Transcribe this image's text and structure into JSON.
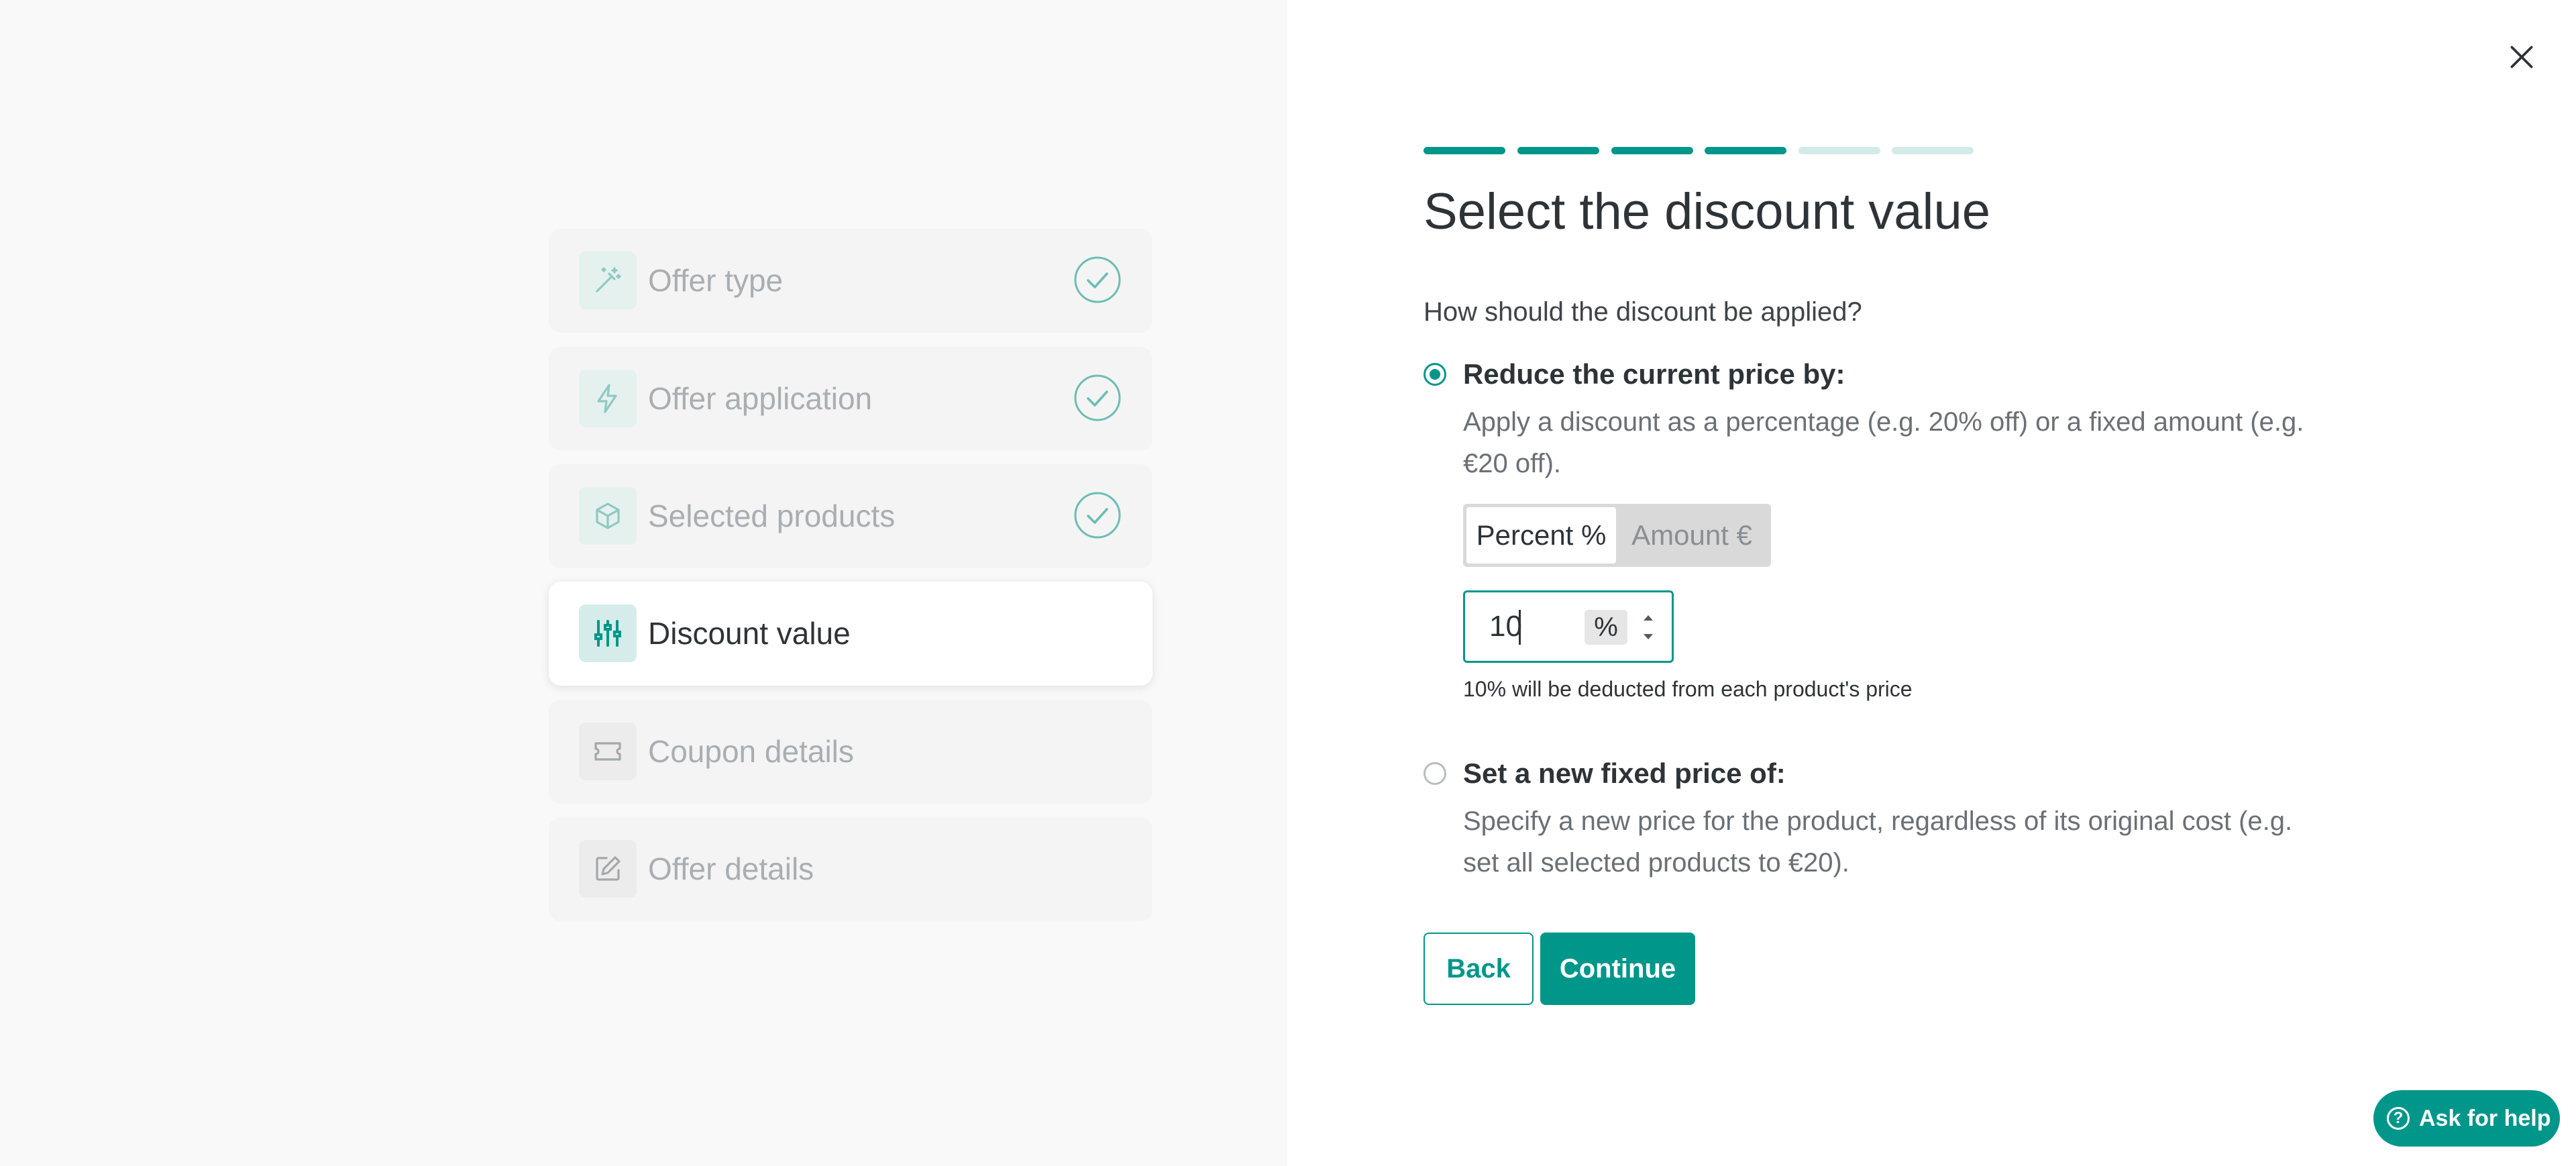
{
  "colors": {
    "accent": "#00968a",
    "accent_light": "#d3ebe8",
    "muted_text": "#a9aeb2"
  },
  "steps": [
    {
      "label": "Offer type",
      "icon": "magic-wand-icon",
      "status": "completed"
    },
    {
      "label": "Offer application",
      "icon": "lightning-icon",
      "status": "completed"
    },
    {
      "label": "Selected products",
      "icon": "box-icon",
      "status": "completed"
    },
    {
      "label": "Discount value",
      "icon": "sliders-icon",
      "status": "active"
    },
    {
      "label": "Coupon details",
      "icon": "ticket-icon",
      "status": "pending"
    },
    {
      "label": "Offer details",
      "icon": "edit-icon",
      "status": "pending"
    }
  ],
  "progress": {
    "total_steps": 6,
    "completed_steps": 4
  },
  "main": {
    "title": "Select the discount value",
    "question": "How should the discount be applied?",
    "option_reduce": {
      "title": "Reduce the current price by:",
      "description": "Apply a discount as a percentage (e.g. 20% off) or a fixed amount (e.g. €20 off).",
      "selected": true
    },
    "segmented": {
      "percent_label": "Percent %",
      "amount_label": "Amount €",
      "selected": "percent"
    },
    "value_input": {
      "value": "10",
      "unit": "%"
    },
    "hint": "10% will be deducted from each product's price",
    "option_fixed": {
      "title": "Set a new fixed price of:",
      "description": "Specify a new price for the product, regardless of its original cost (e.g. set all selected products to €20).",
      "selected": false
    },
    "back_label": "Back",
    "continue_label": "Continue"
  },
  "help": {
    "label": "Ask for help",
    "icon": "question-circle-icon"
  },
  "close_icon": "close-icon"
}
